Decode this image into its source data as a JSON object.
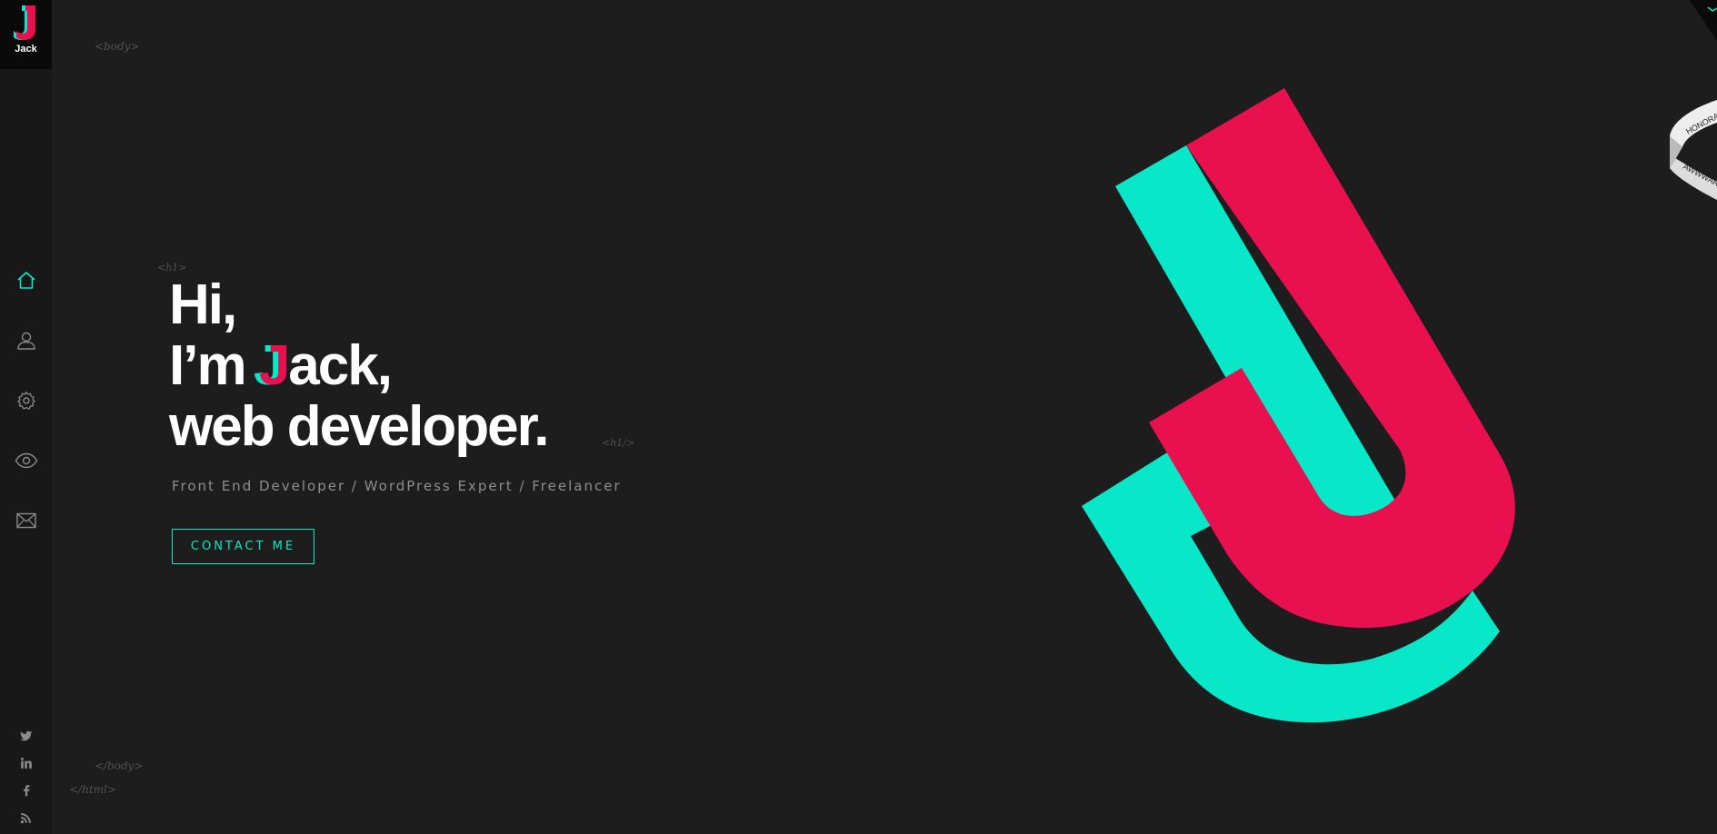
{
  "logo": {
    "letter": "J",
    "name": "Jack"
  },
  "nav": {
    "items": [
      {
        "icon": "home-icon",
        "label": "Home",
        "active": true
      },
      {
        "icon": "user-icon",
        "label": "About",
        "active": false
      },
      {
        "icon": "gear-icon",
        "label": "Skills",
        "active": false
      },
      {
        "icon": "eye-icon",
        "label": "Work",
        "active": false
      },
      {
        "icon": "envelope-icon",
        "label": "Contact",
        "active": false
      }
    ]
  },
  "social": {
    "items": [
      {
        "icon": "twitter-icon"
      },
      {
        "icon": "linkedin-icon"
      },
      {
        "icon": "facebook-icon"
      },
      {
        "icon": "rss-icon"
      }
    ]
  },
  "code_tags": {
    "body_open": "<body>",
    "h1_open": "<h1>",
    "h1_close": "<h1/>",
    "body_close": "</body>",
    "html_close": "</html>"
  },
  "hero": {
    "line1": "Hi,",
    "line2_prefix": "I’m ",
    "line2_letter": "J",
    "line2_suffix": "ack,",
    "line3": "web developer.",
    "subtitle": "Front End Developer / WordPress Expert / Freelancer",
    "cta_label": "CONTACT ME"
  },
  "award": {
    "line1": "HONORABLE",
    "line2": "AWWWARDS"
  },
  "colors": {
    "background": "#1d1d1d",
    "sidebar": "#181818",
    "accent_teal": "#08e8c9",
    "accent_pink": "#e8104f",
    "icon_gray": "#8a8a8a"
  }
}
